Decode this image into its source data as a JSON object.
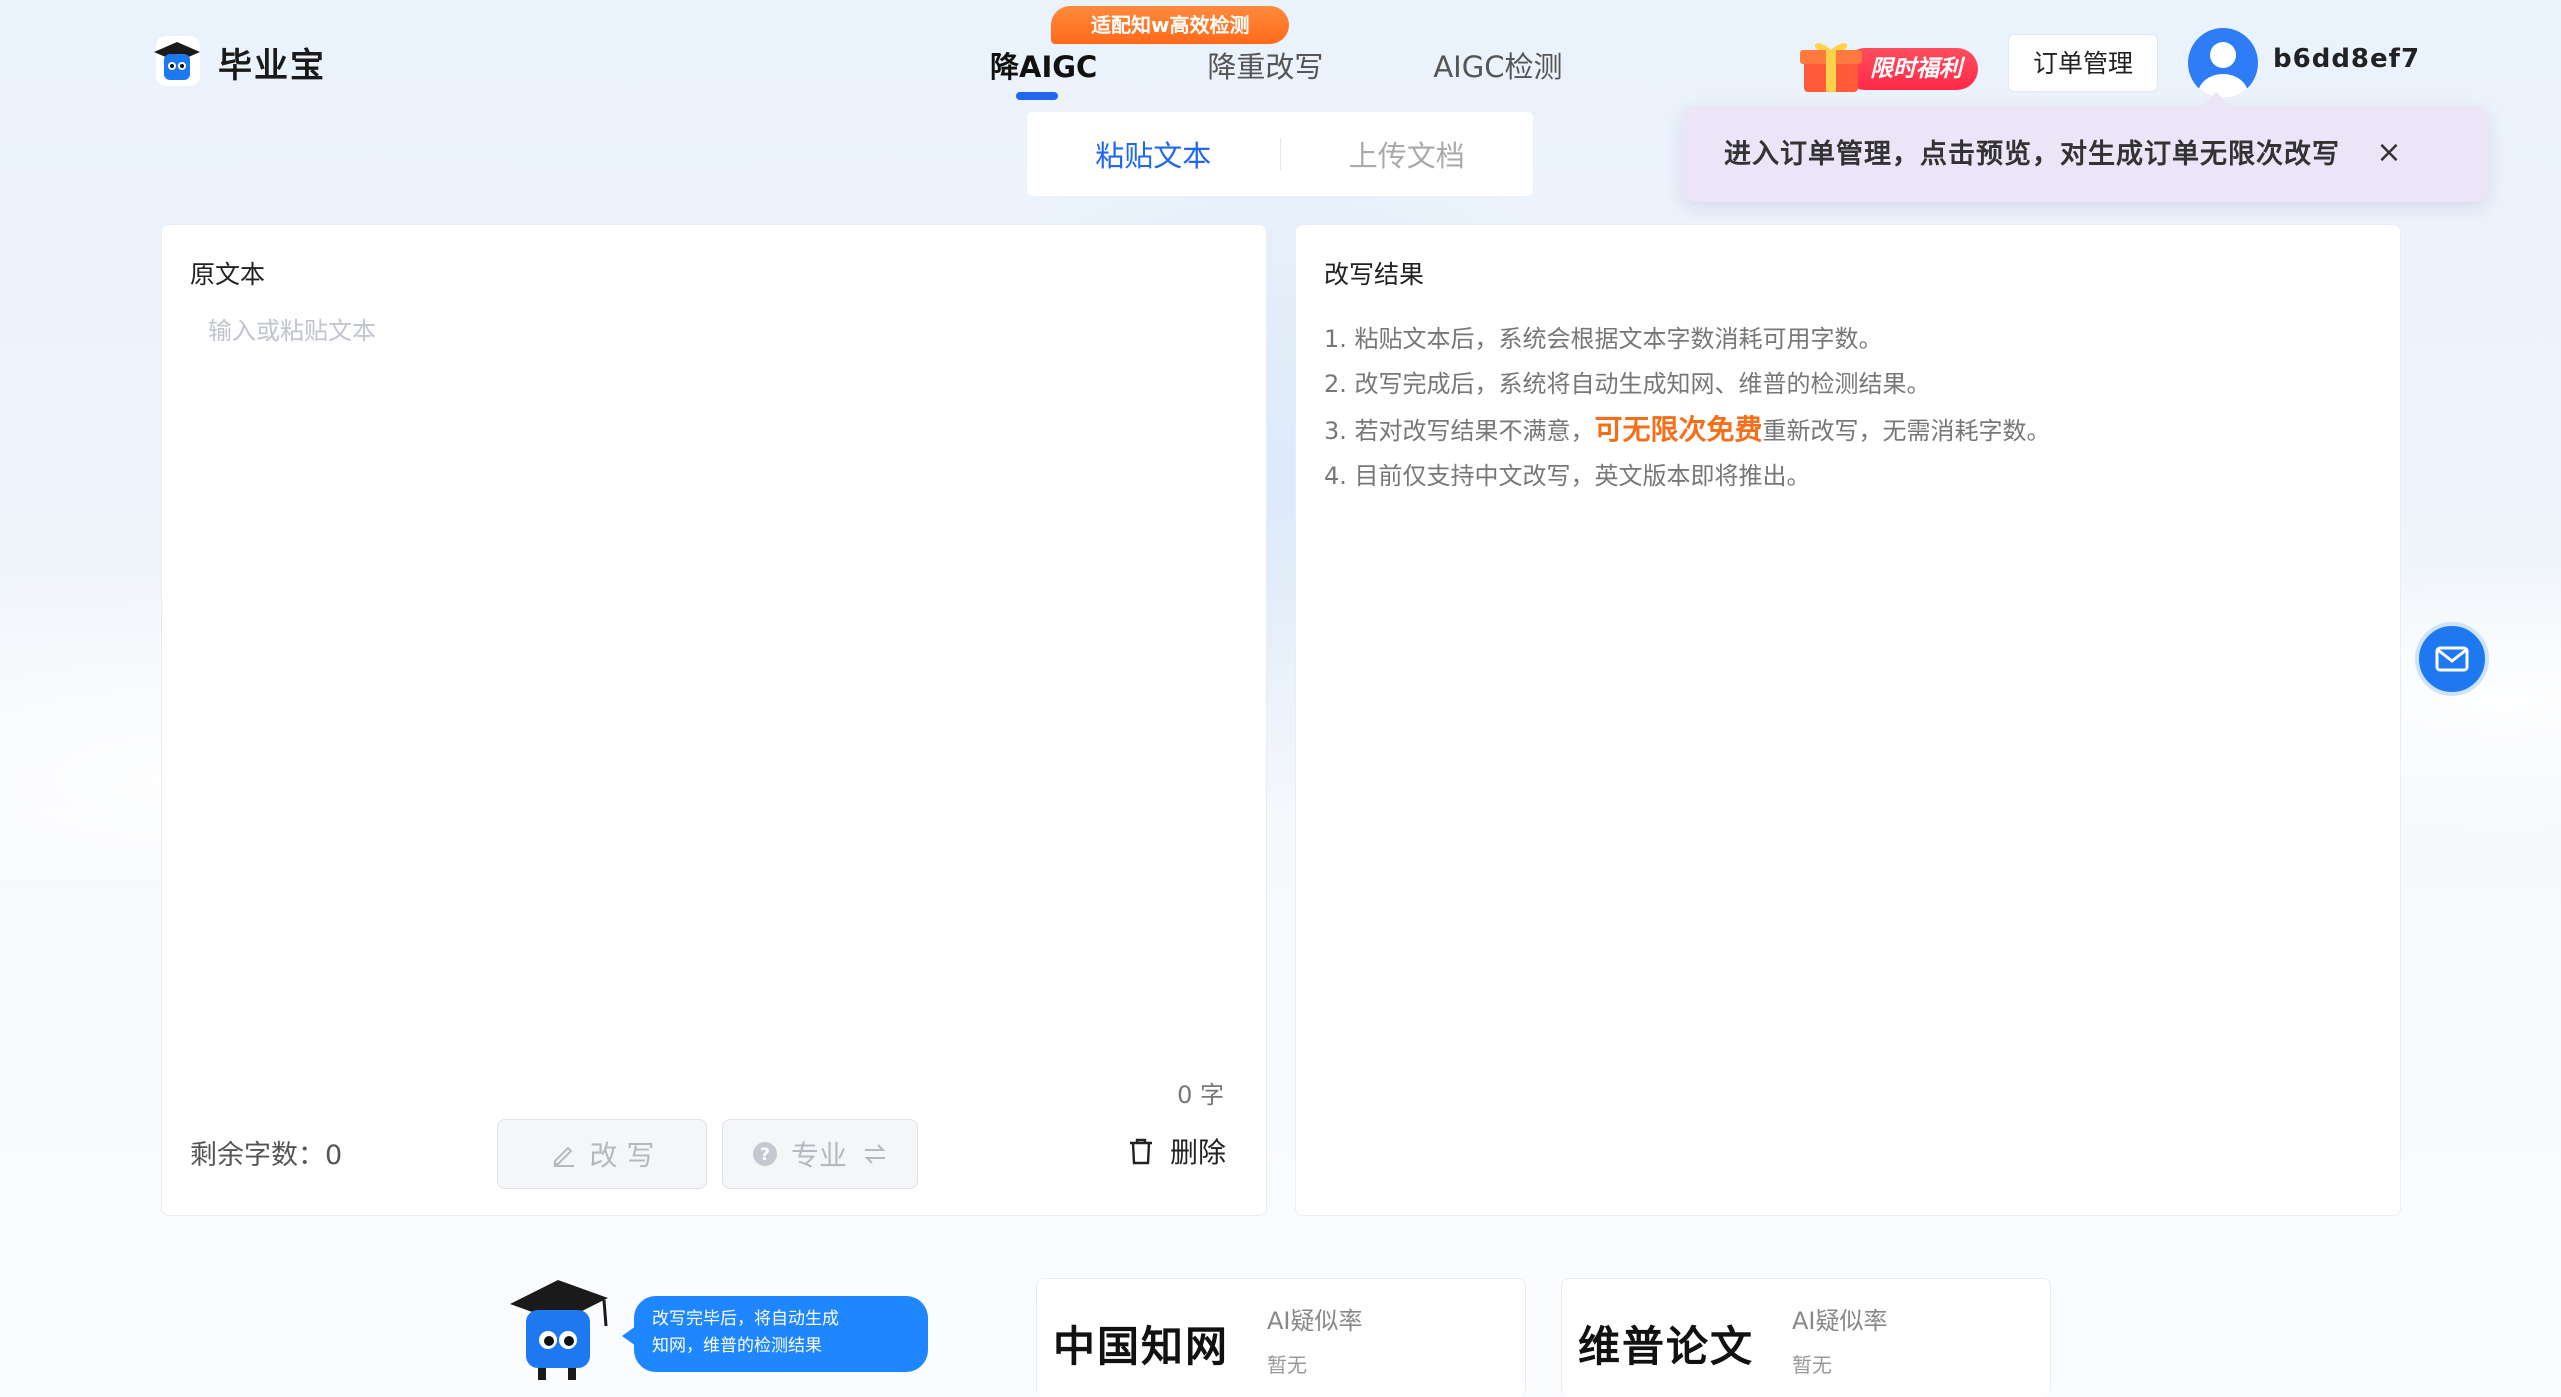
{
  "brand": {
    "name": "毕业宝"
  },
  "nav": {
    "badge": "适配知w高效检测",
    "items": [
      "降AIGC",
      "降重改写",
      "AIGC检测"
    ]
  },
  "header": {
    "promo": "限时福利",
    "order_button": "订单管理",
    "username": "b6dd8ef7"
  },
  "tooltip": {
    "text": "进入订单管理，点击预览，对生成订单无限次改写",
    "close": "×"
  },
  "tabs": [
    "粘贴文本",
    "上传文档"
  ],
  "left_panel": {
    "title": "原文本",
    "placeholder": "输入或粘贴文本",
    "char_count": "0 字",
    "remaining_label": "剩余字数：",
    "remaining_value": "0",
    "rewrite_button": "改 写",
    "pro_button": "专业",
    "delete_button": "删除"
  },
  "right_panel": {
    "title": "改写结果",
    "tips": [
      "1. 粘贴文本后，系统会根据文本字数消耗可用字数。",
      "2. 改写完成后，系统将自动生成知网、维普的检测结果。"
    ],
    "tip3_prefix": "3. 若对改写结果不满意，",
    "tip3_highlight": "可无限次免费",
    "tip3_suffix": "重新改写，无需消耗字数。",
    "tip4": "4. 目前仅支持中文改写，英文版本即将推出。"
  },
  "bottom": {
    "bubble_line1": "改写完毕后，将自动生成",
    "bubble_line2": "知网，维普的检测结果",
    "cards": [
      {
        "brand": "中国知网",
        "label": "AI疑似率",
        "value": "暂无"
      },
      {
        "brand": "维普论文",
        "label": "AI疑似率",
        "value": "暂无"
      }
    ]
  },
  "colors": {
    "accent": "#2167f0",
    "highlight": "#f56f1a",
    "badge": "#ff6a1a",
    "promo": "#ff2a48"
  }
}
